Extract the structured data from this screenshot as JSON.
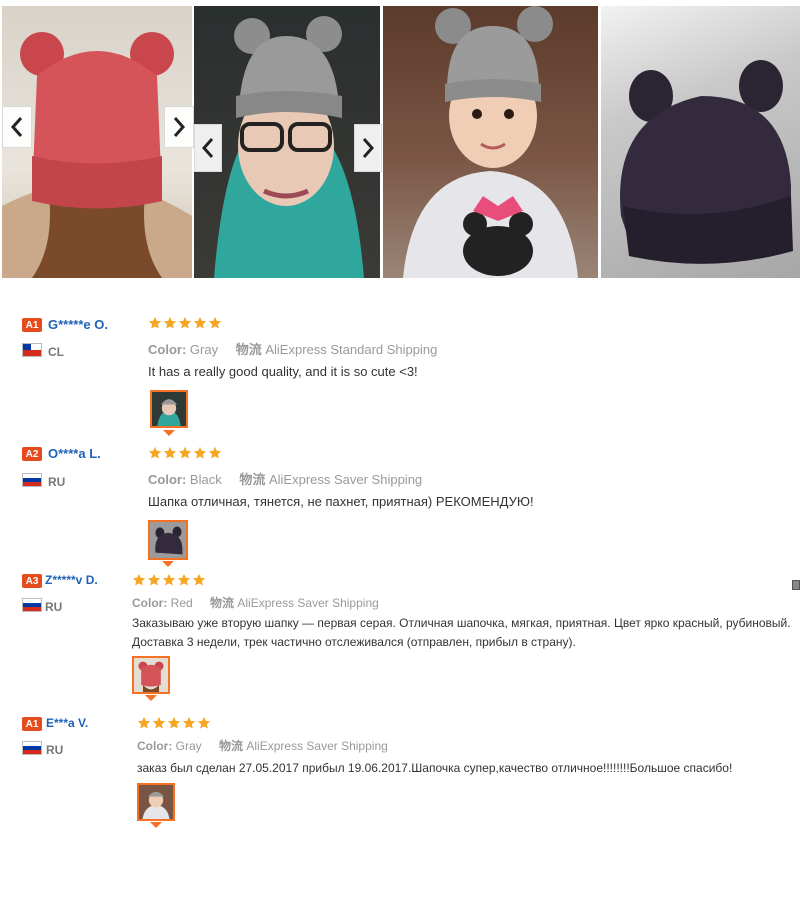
{
  "gallery": {
    "images": [
      {
        "name": "red-hat-back-photo"
      },
      {
        "name": "gray-hat-woman-photo"
      },
      {
        "name": "gray-hat-child-photo"
      },
      {
        "name": "black-hat-photo"
      }
    ],
    "icons": {
      "prev": "chevron-left-icon",
      "next": "chevron-right-icon"
    }
  },
  "colors": {
    "accent": "#f57224",
    "badge": "#e64b1e",
    "username": "#1f62b8",
    "star": "#f5a623"
  },
  "reviews": [
    {
      "badge": "A1",
      "user": "G*****e O.",
      "country": "CL",
      "rating": 5,
      "color_label": "Color:",
      "color_value": "Gray",
      "logistics_label": "物流",
      "shipping": "AliExpress Standard Shipping",
      "text": "It has a really good quality, and it is so cute <3!"
    },
    {
      "badge": "A2",
      "user": "O****a L.",
      "country": "RU",
      "rating": 5,
      "color_label": "Color:",
      "color_value": "Black",
      "logistics_label": "物流",
      "shipping": "AliExpress Saver Shipping",
      "text": "Шапка отличная, тянется, не пахнет, приятная) РЕКОМЕНДУЮ!"
    },
    {
      "badge": "A3",
      "user": "Z*****v D.",
      "country": "RU",
      "rating": 5,
      "color_label": "Color:",
      "color_value": "Red",
      "logistics_label": "物流",
      "shipping": "AliExpress Saver Shipping",
      "text_line1": "Заказываю уже вторую шапку — первая серая. Отличная шапочка, мягкая, приятная. Цвет ярко красный, рубиновый.",
      "text_line2": "Доставка 3 недели, трек частично отслеживался (отправлен, прибыл в страну)."
    },
    {
      "badge": "A1",
      "user": "E***a V.",
      "country": "RU",
      "rating": 5,
      "color_label": "Color:",
      "color_value": "Gray",
      "logistics_label": "物流",
      "shipping": "AliExpress Saver Shipping",
      "text": "заказ был сделан 27.05.2017 прибыл 19.06.2017.Шапочка супер,качество отличное!!!!!!!!Большое спасибо!"
    }
  ]
}
